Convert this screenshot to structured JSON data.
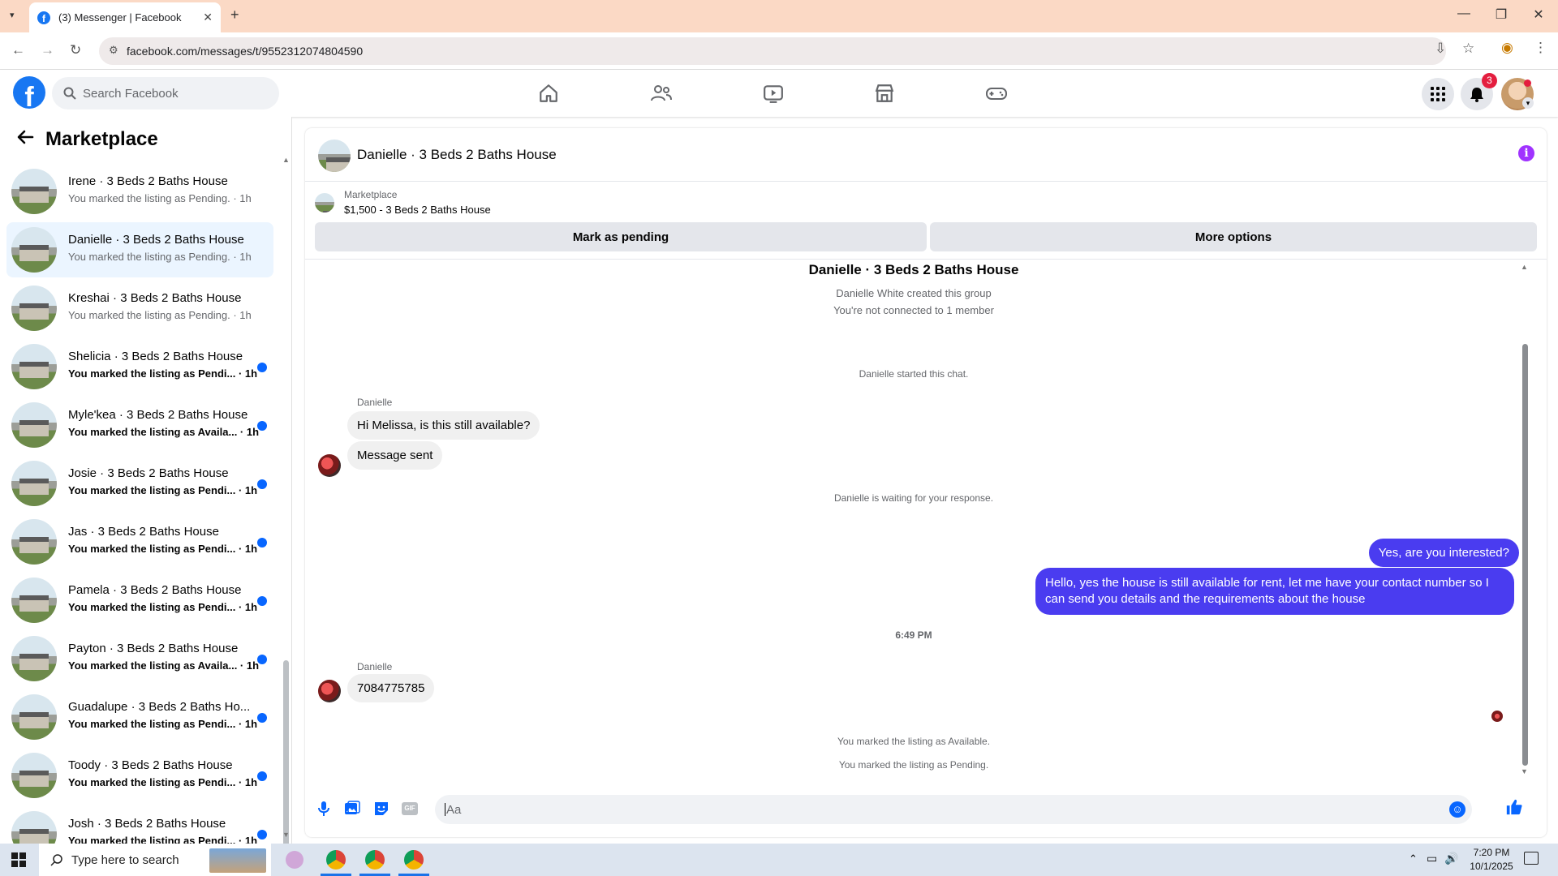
{
  "browser": {
    "tab_title": "(3) Messenger | Facebook",
    "url": "facebook.com/messages/t/9552312074804590"
  },
  "header": {
    "search_placeholder": "Search Facebook",
    "notification_count": "3"
  },
  "sidebar": {
    "title": "Marketplace",
    "conversations": [
      {
        "name": "Irene · 3 Beds 2 Baths House",
        "snippet": "You marked the listing as Pending. · 1h",
        "unread": false,
        "selected": false
      },
      {
        "name": "Danielle · 3 Beds 2 Baths House",
        "snippet": "You marked the listing as Pending. · 1h",
        "unread": false,
        "selected": true
      },
      {
        "name": "Kreshai · 3 Beds 2 Baths House",
        "snippet": "You marked the listing as Pending. · 1h",
        "unread": false,
        "selected": false
      },
      {
        "name": "Shelicia · 3 Beds 2 Baths House",
        "snippet": "You marked the listing as Pendi... · 1h",
        "unread": true,
        "selected": false
      },
      {
        "name": "Myle'kea · 3 Beds 2 Baths House",
        "snippet": "You marked the listing as Availa... · 1h",
        "unread": true,
        "selected": false
      },
      {
        "name": "Josie · 3 Beds 2 Baths House",
        "snippet": "You marked the listing as Pendi... · 1h",
        "unread": true,
        "selected": false
      },
      {
        "name": "Jas · 3 Beds 2 Baths House",
        "snippet": "You marked the listing as Pendi... · 1h",
        "unread": true,
        "selected": false
      },
      {
        "name": "Pamela · 3 Beds 2 Baths House",
        "snippet": "You marked the listing as Pendi... · 1h",
        "unread": true,
        "selected": false
      },
      {
        "name": "Payton · 3 Beds 2 Baths House",
        "snippet": "You marked the listing as Availa... · 1h",
        "unread": true,
        "selected": false
      },
      {
        "name": "Guadalupe · 3 Beds 2 Baths Ho...",
        "snippet": "You marked the listing as Pendi... · 1h",
        "unread": true,
        "selected": false
      },
      {
        "name": "Toody · 3 Beds 2 Baths House",
        "snippet": "You marked the listing as Pendi... · 1h",
        "unread": true,
        "selected": false
      },
      {
        "name": "Josh · 3 Beds 2 Baths House",
        "snippet": "You marked the listing as Pendi... · 1h",
        "unread": true,
        "selected": false
      }
    ]
  },
  "chat": {
    "title": "Danielle · 3 Beds 2 Baths House",
    "listing": {
      "source": "Marketplace",
      "price_title": "$1,500 - 3 Beds 2 Baths House",
      "mark_pending": "Mark as pending",
      "more_options": "More options"
    },
    "intro_title": "Danielle · 3 Beds 2 Baths House",
    "intro_created": "Danielle White created this group",
    "intro_connected": "You're not connected to 1 member",
    "started": "Danielle started this chat.",
    "sender1": "Danielle",
    "msg1": "Hi Melissa, is this still available?",
    "msg2": "Message sent",
    "waiting": "Danielle is waiting for your response.",
    "reply1": "Yes, are you interested?",
    "reply2_line1": "Hello, yes the house is still available for rent, let me have your contact number so I",
    "reply2_line2": "can send you details and the requirements about the house",
    "time": "6:49 PM",
    "sender2": "Danielle",
    "msg3": "7084775785",
    "status1": "You marked the listing as Available.",
    "status2": "You marked the listing as Pending.",
    "composer_placeholder": "Aa"
  },
  "taskbar": {
    "search_placeholder": "Type here to search",
    "time": "7:20 PM",
    "date": "10/1/2025"
  },
  "colors": {
    "accent": "#1877f2",
    "bubble_me": "#4a3cf0",
    "unread_dot": "#0866ff"
  }
}
